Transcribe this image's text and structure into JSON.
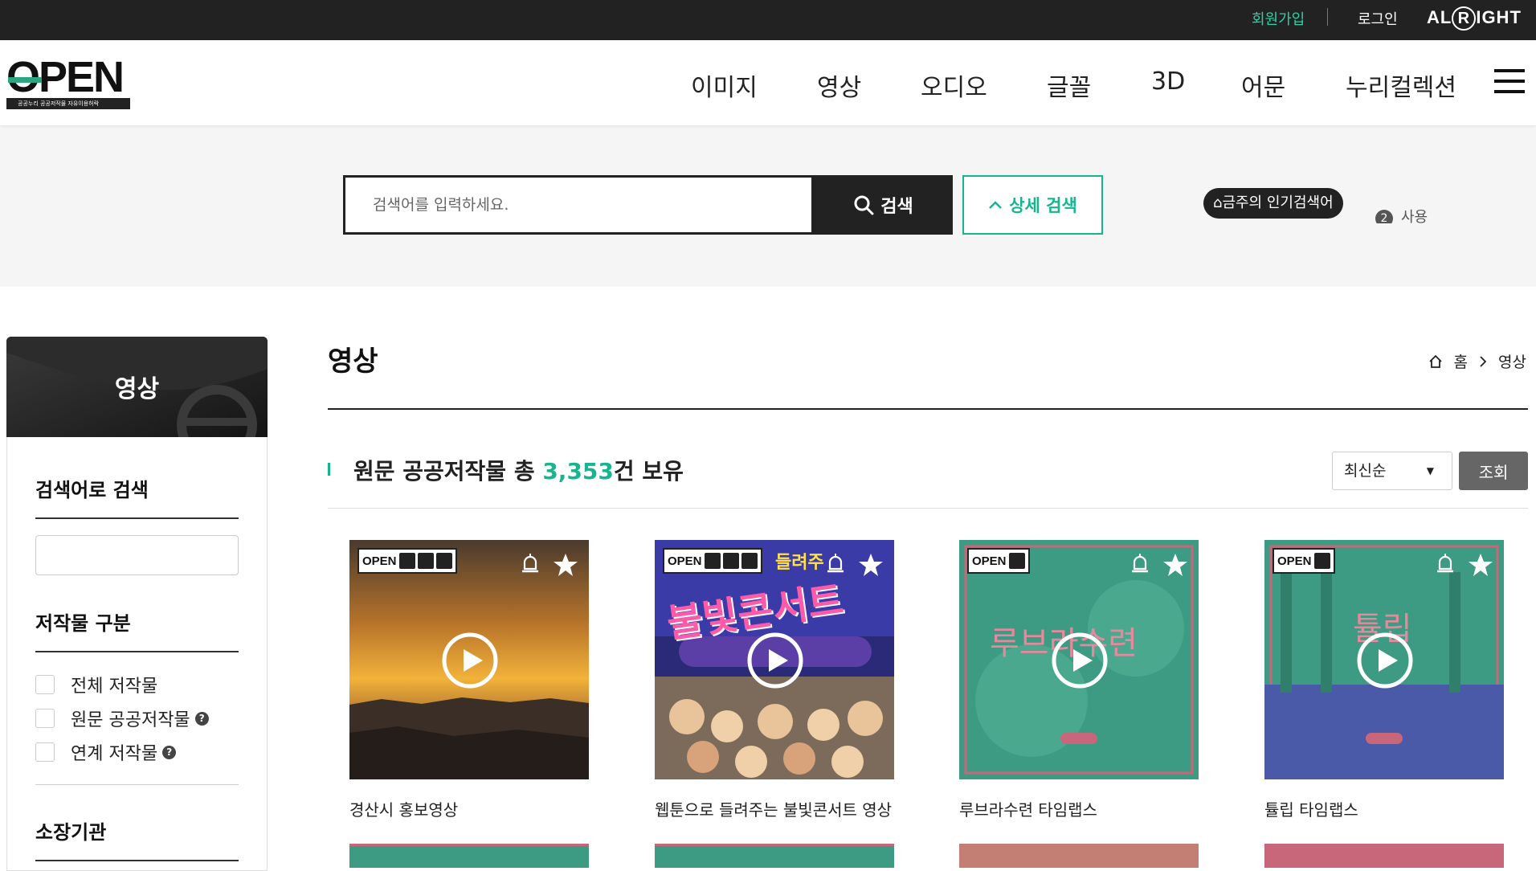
{
  "topbar": {
    "join": "회원가입",
    "login": "로그인",
    "brand_prefix": "AL",
    "brand_r": "R",
    "brand_suffix": "IGHT"
  },
  "header": {
    "logo_text": "OPEN",
    "logo_sub": "공공누리 공공저작물 자유이용허락",
    "nav": [
      "이미지",
      "영상",
      "오디오",
      "글꼴",
      "3D",
      "어문",
      "누리컬렉션"
    ]
  },
  "search": {
    "placeholder": "검색어를 입력하세요.",
    "button": "검색",
    "advanced": "상세 검색",
    "popular_label": "금주의 인기검색어",
    "popular_first_num": "2",
    "popular_first": "사용"
  },
  "sidebar": {
    "title": "영상",
    "keyword_title": "검색어로 검색",
    "category_title": "저작물 구분",
    "categories": [
      "전체 저작물",
      "원문 공공저작물",
      "연계 저작물"
    ],
    "org_title": "소장기관"
  },
  "main": {
    "title": "영상",
    "breadcrumb": [
      "홈",
      "영상"
    ],
    "count_prefix": "원문 공공저작물 총 ",
    "count": "3,353",
    "count_suffix": "건 보유",
    "sort_value": "최신순",
    "query_button": "조회",
    "cards": [
      {
        "title": "경산시 홍보영상"
      },
      {
        "title": "웹툰으로 들려주는 불빛콘서트 영상"
      },
      {
        "title": "루브라수련 타임랩스"
      },
      {
        "title": "튤립 타임랩스"
      }
    ],
    "poster_text": "불빛콘서트",
    "poster_subtitle": "들려주",
    "lotus_text": "루브라수련",
    "tulip_text": "튤립"
  },
  "colors": {
    "accent": "#17b58f",
    "topbar_bg": "#222222",
    "dark": "#1f1f1f"
  }
}
